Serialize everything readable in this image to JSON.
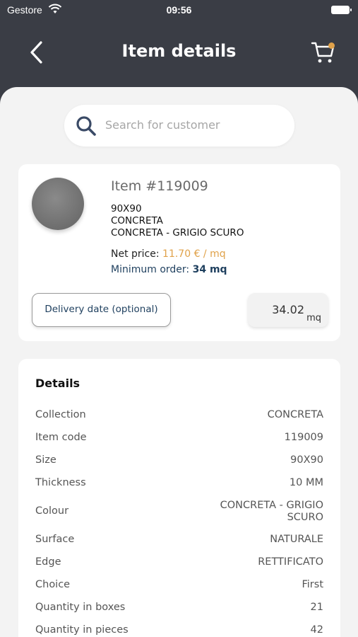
{
  "status_bar": {
    "carrier": "Gestore",
    "time": "09:56"
  },
  "nav": {
    "title": "Item details"
  },
  "search": {
    "placeholder": "Search for customer"
  },
  "item": {
    "number": "Item #119009",
    "size": "90X90",
    "collection": "CONCRETA",
    "name": "CONCRETA - GRIGIO SCURO",
    "net_price_label": "Net price: ",
    "net_price_value": "11.70 € / mq",
    "min_order_label": "Minimum order: ",
    "min_order_value": "34 mq",
    "delivery_label": "Delivery date (optional)",
    "quantity": "34.02",
    "quantity_unit": "mq"
  },
  "details": {
    "heading": "Details",
    "rows": [
      {
        "label": "Collection",
        "value": "CONCRETA"
      },
      {
        "label": "Item code",
        "value": "119009"
      },
      {
        "label": "Size",
        "value": "90X90"
      },
      {
        "label": "Thickness",
        "value": "10 MM"
      },
      {
        "label": "Colour",
        "value": "CONCRETA - GRIGIO SCURO"
      },
      {
        "label": "Surface",
        "value": "NATURALE"
      },
      {
        "label": "Edge",
        "value": "RETTIFICATO"
      },
      {
        "label": "Choice",
        "value": "First"
      },
      {
        "label": "Quantity in boxes",
        "value": "21"
      },
      {
        "label": "Quantity in pieces",
        "value": "42"
      }
    ]
  },
  "colors": {
    "header_bg": "#3a3d45",
    "accent": "#e0a24a",
    "navy": "#1e3f5e",
    "sheet_bg": "#f3f3f3"
  },
  "icons": [
    "wifi-icon",
    "battery-icon",
    "back-chevron-icon",
    "cart-icon",
    "search-icon"
  ]
}
